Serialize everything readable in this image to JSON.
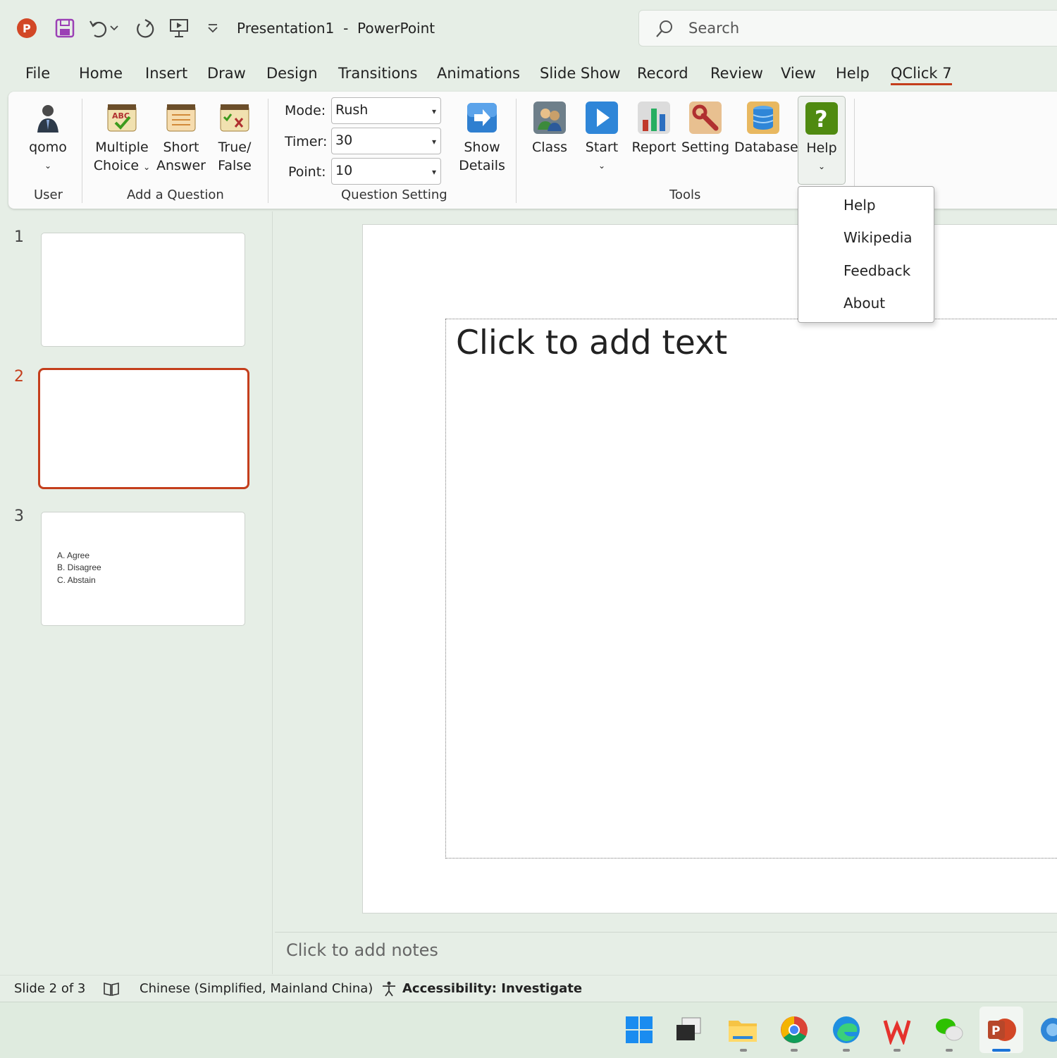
{
  "titlebar": {
    "document": "Presentation1",
    "separator": "-",
    "app": "PowerPoint",
    "search_placeholder": "Search",
    "quick_access_icons": [
      "powerpoint-logo-icon",
      "save-icon",
      "undo-icon",
      "undo-dropdown-icon",
      "redo-icon",
      "present-icon",
      "customize-icon"
    ]
  },
  "tabs": [
    "File",
    "Home",
    "Insert",
    "Draw",
    "Design",
    "Transitions",
    "Animations",
    "Slide Show",
    "Record",
    "Review",
    "View",
    "Help",
    "QClick 7"
  ],
  "active_tab": "QClick 7",
  "ribbon": {
    "user": {
      "button": "qomo",
      "group": "User"
    },
    "add_question": {
      "group": "Add a Question",
      "multiple_choice": [
        "Multiple",
        "Choice"
      ],
      "short_answer": [
        "Short",
        "Answer"
      ],
      "true_false": [
        "True/",
        "False"
      ]
    },
    "question_setting": {
      "group": "Question Setting",
      "mode_label": "Mode:",
      "mode_value": "Rush",
      "timer_label": "Timer:",
      "timer_value": "30",
      "point_label": "Point:",
      "point_value": "10",
      "show_details": [
        "Show",
        "Details"
      ]
    },
    "tools": {
      "group": "Tools",
      "class": "Class",
      "start": "Start",
      "report": "Report",
      "setting": "Setting",
      "database": "Database",
      "help": "Help"
    }
  },
  "help_menu": [
    "Help",
    "Wikipedia",
    "Feedback",
    "About"
  ],
  "slides": {
    "numbers": [
      "1",
      "2",
      "3"
    ],
    "selected": 2,
    "slide3_options": [
      "A. Agree",
      "B. Disagree",
      "C. Abstain"
    ]
  },
  "editor": {
    "placeholder": "Click to add text",
    "notes": "Click to add notes"
  },
  "status": {
    "slide": "Slide 2 of 3",
    "language": "Chinese (Simplified, Mainland China)",
    "accessibility": "Accessibility: Investigate"
  },
  "colors": {
    "accent": "#c43e1c",
    "background": "#e6eee6",
    "help_icon": "#4f8a10"
  },
  "taskbar_icons": [
    "windows-start-icon",
    "task-view-icon",
    "file-explorer-icon",
    "chrome-icon",
    "edge-icon",
    "wps-icon",
    "wechat-icon",
    "powerpoint-taskbar-icon",
    "app-icon"
  ]
}
